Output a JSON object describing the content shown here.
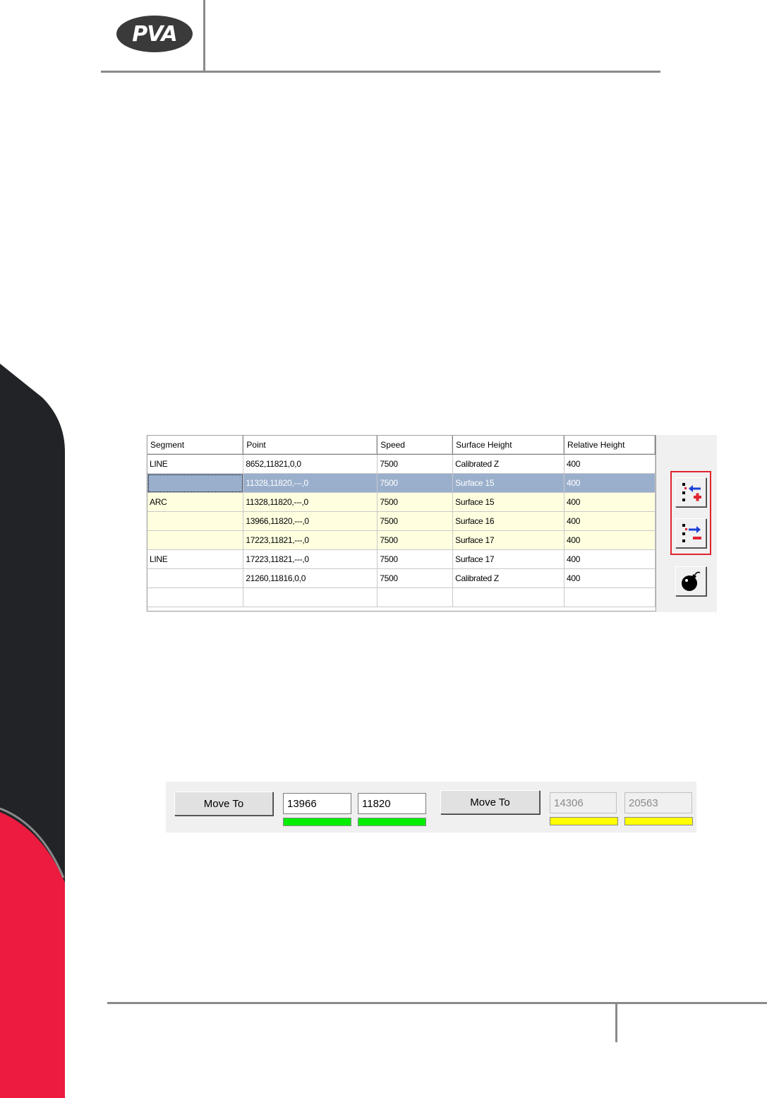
{
  "header": {
    "logo_text": "PVA"
  },
  "grid": {
    "columns": [
      "Segment",
      "Point",
      "Speed",
      "Surface Height",
      "Relative Height"
    ],
    "rows": [
      {
        "segment": "LINE",
        "point": "8652,11821,0,0",
        "speed": "7500",
        "surface": "Calibrated Z",
        "relative": "400",
        "style": "normal"
      },
      {
        "segment": "",
        "point": "11328,11820,---,0",
        "speed": "7500",
        "surface": "Surface 15",
        "relative": "400",
        "style": "selected"
      },
      {
        "segment": "ARC",
        "point": "11328,11820,---,0",
        "speed": "7500",
        "surface": "Surface 15",
        "relative": "400",
        "style": "arc"
      },
      {
        "segment": "",
        "point": "13966,11820,---,0",
        "speed": "7500",
        "surface": "Surface 16",
        "relative": "400",
        "style": "arc"
      },
      {
        "segment": "",
        "point": "17223,11821,---,0",
        "speed": "7500",
        "surface": "Surface 17",
        "relative": "400",
        "style": "arc"
      },
      {
        "segment": "LINE",
        "point": "17223,11821,---,0",
        "speed": "7500",
        "surface": "Surface 17",
        "relative": "400",
        "style": "normal"
      },
      {
        "segment": "",
        "point": "21260,11816,0,0",
        "speed": "7500",
        "surface": "Calibrated Z",
        "relative": "400",
        "style": "normal"
      },
      {
        "segment": "",
        "point": "",
        "speed": "",
        "surface": "",
        "relative": "",
        "style": "normal"
      }
    ],
    "side_buttons": [
      {
        "name": "insert-point-button",
        "icon": "insert-point-icon"
      },
      {
        "name": "remove-point-button",
        "icon": "remove-point-icon"
      },
      {
        "name": "bomb-button",
        "icon": "bomb-icon"
      }
    ],
    "colors": {
      "arc_row": "#ffffe0",
      "selected_row": "#9aafcc",
      "highlight_box": "#e0242f"
    }
  },
  "move_panel": {
    "move_to_label_1": "Move To",
    "x_value": "13966",
    "y_value": "11820",
    "move_to_label_2": "Move To",
    "x_readonly": "14306",
    "y_readonly": "20563",
    "colors": {
      "ok_bar": "#00ee00",
      "warn_bar": "#ffff00"
    }
  },
  "brand_colors": {
    "red": "#ec1b3f",
    "dark": "#222326",
    "gray": "#8a8a8a"
  }
}
